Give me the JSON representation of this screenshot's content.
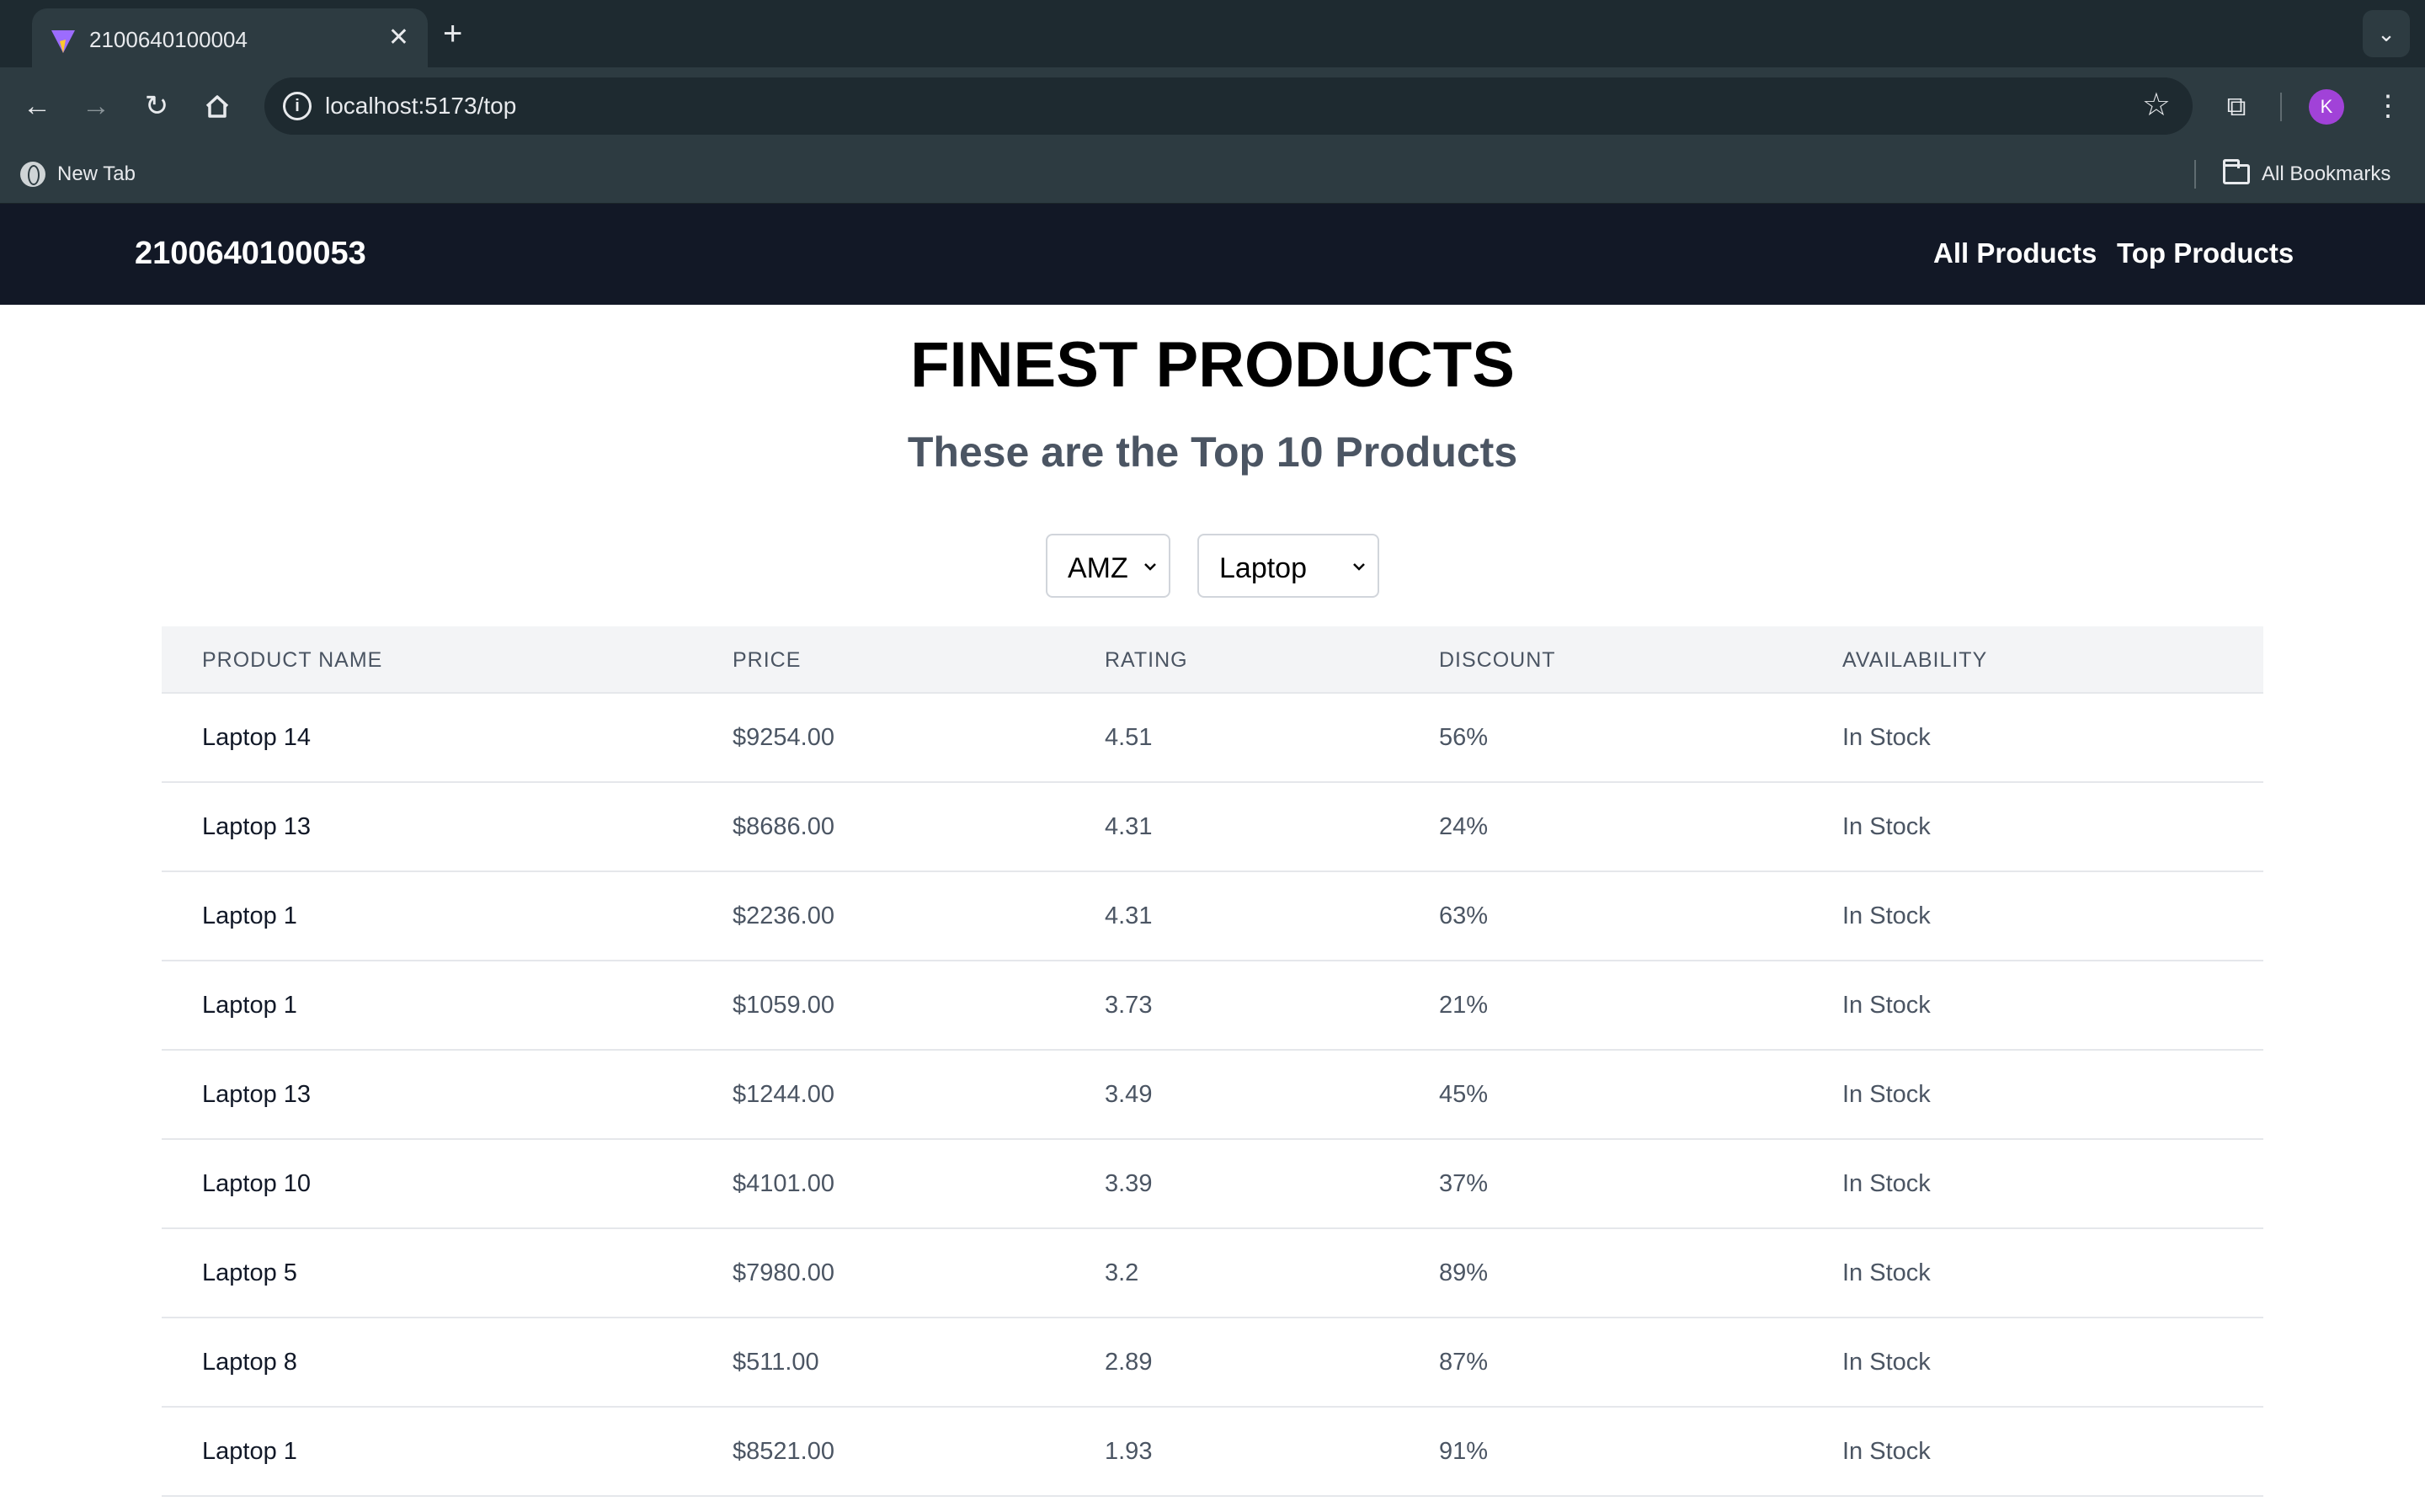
{
  "browser": {
    "tab_title": "2100640100004",
    "url": "localhost:5173/top",
    "bookmark_new_tab": "New Tab",
    "all_bookmarks": "All Bookmarks",
    "avatar_letter": "K"
  },
  "nav": {
    "brand": "2100640100053",
    "links": [
      "All Products",
      "Top Products"
    ]
  },
  "page": {
    "title": "FINEST PRODUCTS",
    "subtitle": "These are the Top 10 Products"
  },
  "filters": {
    "company": "AMZ",
    "category": "Laptop"
  },
  "table": {
    "headers": [
      "PRODUCT NAME",
      "PRICE",
      "RATING",
      "DISCOUNT",
      "AVAILABILITY"
    ],
    "rows": [
      [
        "Laptop 14",
        "$9254.00",
        "4.51",
        "56%",
        "In Stock"
      ],
      [
        "Laptop 13",
        "$8686.00",
        "4.31",
        "24%",
        "In Stock"
      ],
      [
        "Laptop 1",
        "$2236.00",
        "4.31",
        "63%",
        "In Stock"
      ],
      [
        "Laptop 1",
        "$1059.00",
        "3.73",
        "21%",
        "In Stock"
      ],
      [
        "Laptop 13",
        "$1244.00",
        "3.49",
        "45%",
        "In Stock"
      ],
      [
        "Laptop 10",
        "$4101.00",
        "3.39",
        "37%",
        "In Stock"
      ],
      [
        "Laptop 5",
        "$7980.00",
        "3.2",
        "89%",
        "In Stock"
      ],
      [
        "Laptop 8",
        "$511.00",
        "2.89",
        "87%",
        "In Stock"
      ],
      [
        "Laptop 1",
        "$8521.00",
        "1.93",
        "91%",
        "In Stock"
      ]
    ]
  }
}
